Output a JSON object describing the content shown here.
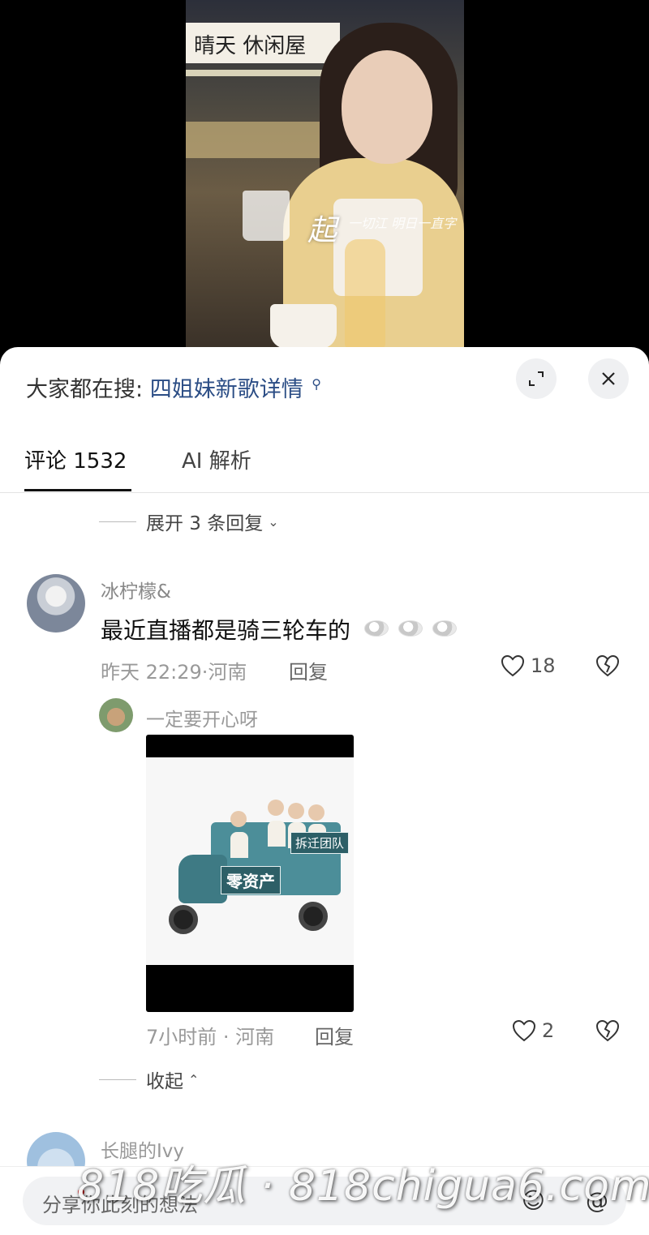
{
  "video": {
    "shop_sign": "晴天 休闲屋",
    "overlay_title": "起",
    "overlay_sub": "一切江 明日一直字"
  },
  "header": {
    "search_prefix": "大家都在搜:",
    "search_query": "四姐妹新歌详情"
  },
  "tabs": {
    "comments": "评论 1532",
    "ai": "AI 解析"
  },
  "thread": {
    "expand_replies": "展开 3 条回复",
    "comment": {
      "user": "冰柠檬&",
      "text": "最近直播都是骑三轮车的",
      "time": "昨天 22:29",
      "location": "河南",
      "reply_label": "回复",
      "likes": "18"
    },
    "reply": {
      "user": "一定要开心呀",
      "image_sign_top": "拆迁团队",
      "image_sign_bottom": "零资产",
      "time": "7小时前",
      "location": "河南",
      "reply_label": "回复",
      "likes": "2"
    },
    "collapse": "收起",
    "next_user": "长腿的Ivy"
  },
  "input": {
    "placeholder": "分享你此刻的想法"
  },
  "watermark": {
    "text": "818吃瓜 · 818chigua6.com"
  }
}
